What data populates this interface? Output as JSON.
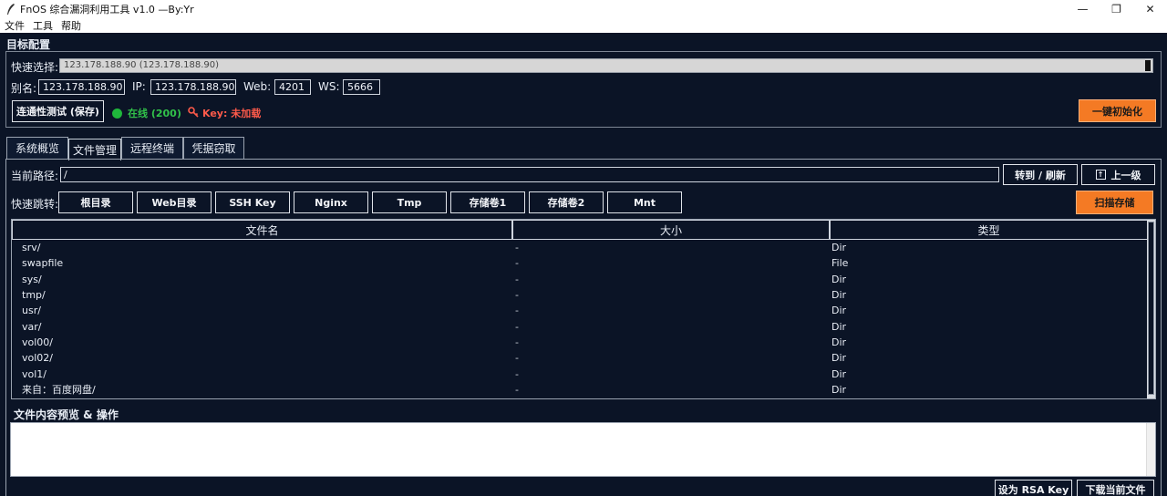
{
  "window": {
    "title": "FnOS 综合漏洞利用工具 v1.0 —By:Yr",
    "minimize": "—",
    "maximize": "❐",
    "close": "✕"
  },
  "menu": [
    "文件",
    "工具",
    "帮助"
  ],
  "target": {
    "section_title": "目标配置",
    "quick_select_label": "快速选择:",
    "quick_select_value": "123.178.188.90 (123.178.188.90)",
    "alias_label": "别名:",
    "alias_value": "123.178.188.90",
    "ip_label": "IP:",
    "ip_value": "123.178.188.90",
    "web_label": "Web:",
    "web_value": "4201",
    "ws_label": "WS:",
    "ws_value": "5666",
    "test_button": "连通性测试 (保存)",
    "online_status": "在线 (200)",
    "key_status": "Key: 未加载",
    "init_button": "一键初始化"
  },
  "tabs": [
    "系统概览",
    "文件管理",
    "远程终端",
    "凭据窃取"
  ],
  "active_tab": "文件管理",
  "file_manager": {
    "path_label": "当前路径:",
    "path_value": "/",
    "goto_button": "转到 / 刷新",
    "up_button": "上一级",
    "quick_jump_label": "快速跳转:",
    "jump_buttons": [
      "根目录",
      "Web目录",
      "SSH Key",
      "Nginx",
      "Tmp",
      "存储卷1",
      "存储卷2",
      "Mnt"
    ],
    "scan_button": "扫描存储",
    "columns": [
      "文件名",
      "大小",
      "类型"
    ],
    "rows": [
      {
        "name": "srv/",
        "size": "-",
        "type": "Dir"
      },
      {
        "name": "swapfile",
        "size": "-",
        "type": "File"
      },
      {
        "name": "sys/",
        "size": "-",
        "type": "Dir"
      },
      {
        "name": "tmp/",
        "size": "-",
        "type": "Dir"
      },
      {
        "name": "usr/",
        "size": "-",
        "type": "Dir"
      },
      {
        "name": "var/",
        "size": "-",
        "type": "Dir"
      },
      {
        "name": "vol00/",
        "size": "-",
        "type": "Dir"
      },
      {
        "name": "vol02/",
        "size": "-",
        "type": "Dir"
      },
      {
        "name": "vol1/",
        "size": "-",
        "type": "Dir"
      },
      {
        "name": "来自：百度网盘/",
        "size": "-",
        "type": "Dir"
      }
    ],
    "preview_title": "文件内容预览 & 操作",
    "set_rsa_button": "设为 RSA Key",
    "download_button": "下载当前文件"
  },
  "colors": {
    "accent": "#f47a24",
    "online": "#31c24a",
    "error": "#ff5a4a",
    "background": "#0b1426"
  }
}
